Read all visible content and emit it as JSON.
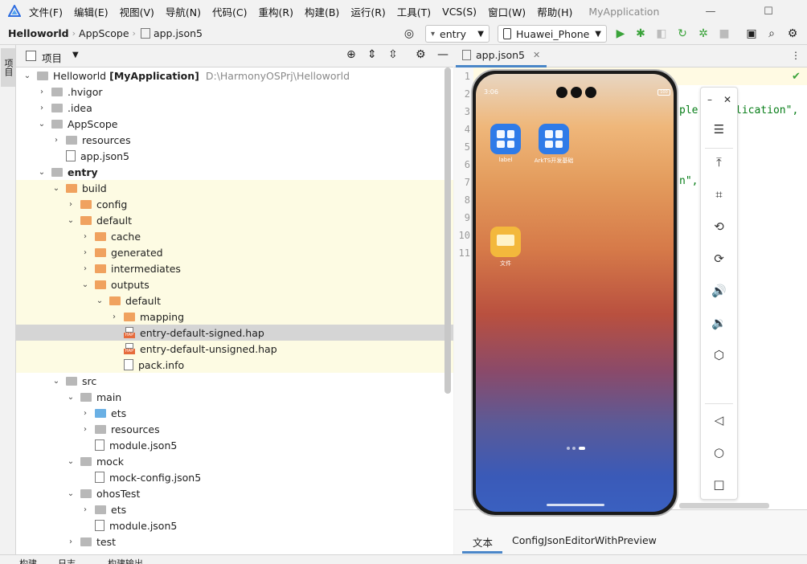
{
  "menubar": {
    "items": [
      "文件(F)",
      "编辑(E)",
      "视图(V)",
      "导航(N)",
      "代码(C)",
      "重构(R)",
      "构建(B)",
      "运行(R)",
      "工具(T)",
      "VCS(S)",
      "窗口(W)",
      "帮助(H)"
    ],
    "app_title": "MyApplication"
  },
  "navbar": {
    "breadcrumbs": [
      "Helloworld",
      "AppScope",
      "app.json5"
    ],
    "run_config": "entry",
    "device": "Huawei_Phone"
  },
  "left_stripe": {
    "tab_label": "项目"
  },
  "project_panel": {
    "title": "项目"
  },
  "tree": [
    {
      "label": "Helloworld",
      "extra": "[MyApplication]",
      "path": "D:\\HarmonyOSPrj\\Helloworld",
      "bold": true
    },
    {
      "label": ".hvigor"
    },
    {
      "label": ".idea"
    },
    {
      "label": "AppScope"
    },
    {
      "label": "resources"
    },
    {
      "label": "app.json5"
    },
    {
      "label": "entry"
    },
    {
      "label": "build"
    },
    {
      "label": "config"
    },
    {
      "label": "default"
    },
    {
      "label": "cache"
    },
    {
      "label": "generated"
    },
    {
      "label": "intermediates"
    },
    {
      "label": "outputs"
    },
    {
      "label": "default"
    },
    {
      "label": "mapping"
    },
    {
      "label": "entry-default-signed.hap"
    },
    {
      "label": "entry-default-unsigned.hap"
    },
    {
      "label": "pack.info"
    },
    {
      "label": "src"
    },
    {
      "label": "main"
    },
    {
      "label": "ets"
    },
    {
      "label": "resources"
    },
    {
      "label": "module.json5"
    },
    {
      "label": "mock"
    },
    {
      "label": "mock-config.json5"
    },
    {
      "label": "ohosTest"
    },
    {
      "label": "ets"
    },
    {
      "label": "module.json5"
    },
    {
      "label": "test"
    }
  ],
  "hap_label": "HAP",
  "editor": {
    "tab": "app.json5",
    "line_numbers": [
      "1",
      "2",
      "3",
      "4",
      "5",
      "6",
      "7",
      "8",
      "9",
      "10",
      "11"
    ],
    "code_fragments": [
      "ple",
      "lication\",",
      "n\","
    ]
  },
  "editor_bottom": {
    "tabs": [
      "文本",
      "ConfigJsonEditorWithPreview"
    ]
  },
  "phone": {
    "time": "3:06",
    "battery": "100",
    "apps": [
      {
        "label": "label",
        "color": "#2f7be8"
      },
      {
        "label": "ArkTS开发基础",
        "color": "#2f7be8"
      },
      {
        "label": "文件",
        "color": "#f3b83c"
      }
    ]
  },
  "bottom_bar": {
    "items": [
      "构建",
      "日志",
      "构建输出"
    ]
  }
}
